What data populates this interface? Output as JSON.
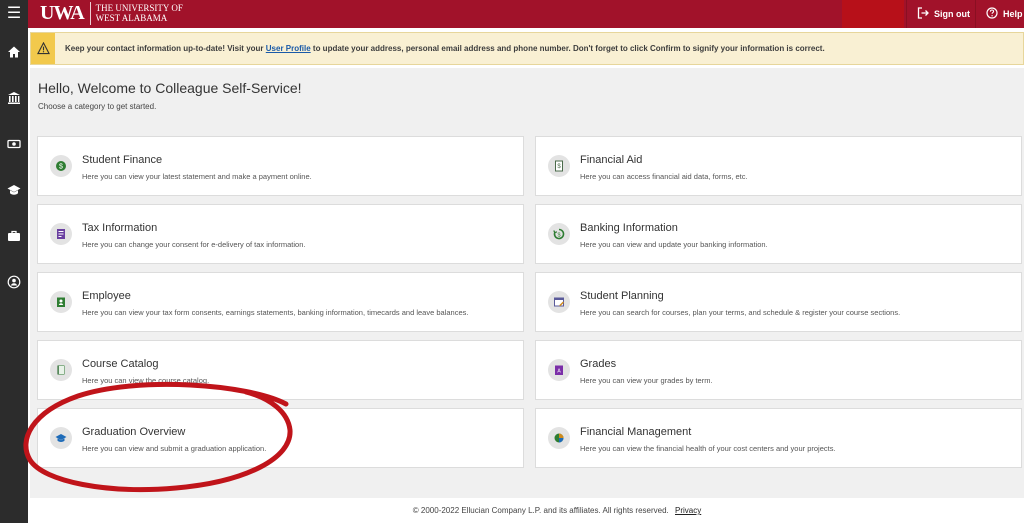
{
  "header": {
    "logo_mark": "UWA",
    "logo_line1": "The University of",
    "logo_line2": "West Alabama",
    "signout_label": "Sign out",
    "help_label": "Help",
    "colors": {
      "bar": "#a1122a"
    }
  },
  "sidebar": {
    "items": [
      {
        "icon": "home-icon"
      },
      {
        "icon": "bank-icon"
      },
      {
        "icon": "money-icon"
      },
      {
        "icon": "graduation-cap-icon"
      },
      {
        "icon": "briefcase-icon"
      },
      {
        "icon": "user-icon"
      }
    ]
  },
  "alert": {
    "prefix": "Keep your contact information up-to-date! Visit your",
    "link": "User Profile",
    "suffix": "to update your address, personal email address and phone number. Don't forget to click Confirm to signify your information is correct."
  },
  "welcome": {
    "title": "Hello, Welcome to Colleague Self-Service!",
    "subtitle": "Choose a category to get started."
  },
  "cards": [
    {
      "title": "Student Finance",
      "desc": "Here you can view your latest statement and make a payment online.",
      "icon": "dollar-icon",
      "color": "#2e7d32"
    },
    {
      "title": "Financial Aid",
      "desc": "Here you can access financial aid data, forms, etc.",
      "icon": "document-dollar-icon",
      "color": "#4a6a4a"
    },
    {
      "title": "Tax Information",
      "desc": "Here you can change your consent for e-delivery of tax information.",
      "icon": "tax-form-icon",
      "color": "#6a3fa0"
    },
    {
      "title": "Banking Information",
      "desc": "Here you can view and update your banking information.",
      "icon": "bank-cycle-icon",
      "color": "#2e7d32"
    },
    {
      "title": "Employee",
      "desc": "Here you can view your tax form consents, earnings statements, banking information, timecards and leave balances.",
      "icon": "id-badge-icon",
      "color": "#2e7d32"
    },
    {
      "title": "Student Planning",
      "desc": "Here you can search for courses, plan your terms, and schedule & register your course sections.",
      "icon": "planner-icon",
      "color": "#5a5a9a"
    },
    {
      "title": "Course Catalog",
      "desc": "Here you can view the course catalog.",
      "icon": "book-icon",
      "color": "#2e7d32"
    },
    {
      "title": "Grades",
      "desc": "Here you can view your grades by term.",
      "icon": "grades-icon",
      "color": "#7b2fa8"
    },
    {
      "title": "Graduation Overview",
      "desc": "Here you can view and submit a graduation application.",
      "icon": "graduation-cap-icon",
      "color": "#1e6bb8"
    },
    {
      "title": "Financial Management",
      "desc": "Here you can view the financial health of your cost centers and your projects.",
      "icon": "pie-chart-icon",
      "color": "#d08a1c"
    }
  ],
  "footer": {
    "text": "© 2000-2022 Ellucian Company L.P. and its affiliates. All rights reserved.",
    "link": "Privacy"
  },
  "annotation": {
    "color": "#c0141a"
  }
}
